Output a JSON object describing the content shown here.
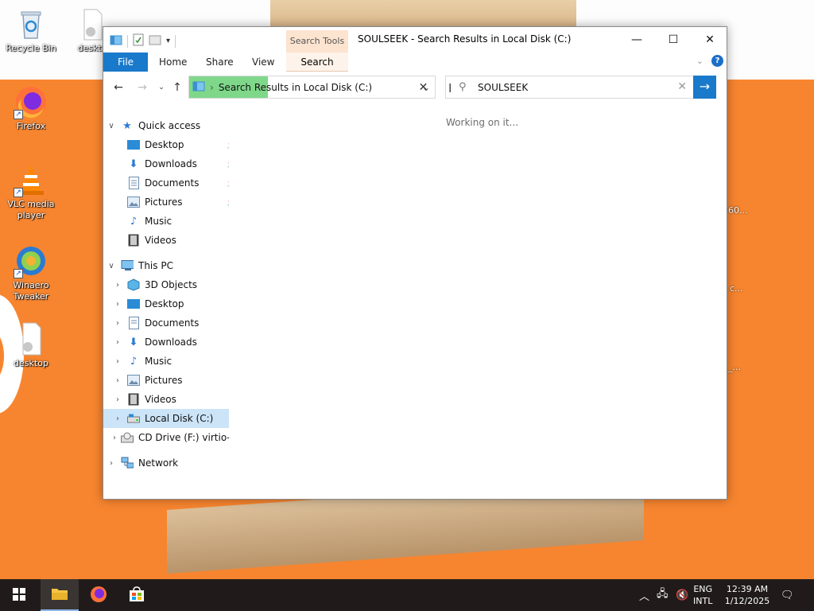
{
  "desktop": {
    "icons": [
      {
        "label": "Recycle Bin"
      },
      {
        "label": "deskto"
      },
      {
        "label": "Firefox"
      },
      {
        "label": "VLC media player"
      },
      {
        "label": "Winaero Tweaker"
      },
      {
        "label": "desktop"
      }
    ],
    "side_fragments": [
      "60...",
      "c...",
      "_..."
    ]
  },
  "window": {
    "title": "SOULSEEK - Search Results in Local Disk (C:)",
    "contextual_tab_group": "Search Tools",
    "controls": {
      "minimize": "—",
      "maximize": "☐",
      "close": "✕"
    }
  },
  "ribbon": {
    "tabs": [
      "File",
      "Home",
      "Share",
      "View",
      "Search"
    ],
    "active_contextual": "Search",
    "help": "?"
  },
  "address": {
    "path": "Search Results in Local Disk (C:)",
    "separator": "›",
    "progress_fraction": 0.32
  },
  "search": {
    "value": "SOULSEEK",
    "clear": "✕",
    "go": "→"
  },
  "navpane": {
    "quick_access": {
      "label": "Quick access",
      "items": [
        "Desktop",
        "Downloads",
        "Documents",
        "Pictures",
        "Music",
        "Videos"
      ]
    },
    "this_pc": {
      "label": "This PC",
      "items": [
        "3D Objects",
        "Desktop",
        "Documents",
        "Downloads",
        "Music",
        "Pictures",
        "Videos",
        "Local Disk (C:)",
        "CD Drive (F:) virtio-win"
      ]
    },
    "network": "Network"
  },
  "results": {
    "status": "Working on it..."
  },
  "taskbar": {
    "language": [
      "ENG",
      "INTL"
    ],
    "time": "12:39 AM",
    "date": "1/12/2025"
  },
  "colors": {
    "accent": "#1979ca",
    "desktop_bg": "#f7852f",
    "progress": "#7fd88a",
    "selected": "#cce4f7"
  }
}
